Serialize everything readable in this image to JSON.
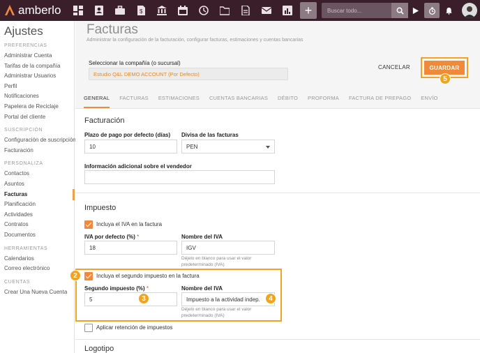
{
  "app": {
    "name": "amberlo"
  },
  "topbar": {
    "icons": [
      "dashboard-icon",
      "contacts-icon",
      "briefcase-icon",
      "billing-icon",
      "bank-icon",
      "calendar-icon",
      "history-icon",
      "folder-icon",
      "documents-icon",
      "mail-icon",
      "reports-icon"
    ],
    "search_placeholder": "Buscar todo..."
  },
  "sidebar": {
    "title": "Ajustes",
    "sections": [
      {
        "label": "PREFERENCIAS",
        "items": [
          "Administrar Cuenta",
          "Tarifas de la compañía",
          "Administrar Usuarios",
          "Perfil",
          "Notificaciones",
          "Papelera de Reciclaje",
          "Portal del cliente"
        ]
      },
      {
        "label": "SUSCRIPCIÓN",
        "items": [
          "Configuración de suscripción",
          "Facturación"
        ]
      },
      {
        "label": "PERSONALIZA",
        "items": [
          "Contactos",
          "Asuntos",
          "Facturas",
          "Planificación",
          "Actividades",
          "Contratos",
          "Documentos"
        ]
      },
      {
        "label": "HERRAMIENTAS",
        "items": [
          "Calendarios",
          "Correo electrónico"
        ]
      },
      {
        "label": "CUENTAS",
        "items": [
          "Crear Una Nueva Cuenta"
        ]
      }
    ],
    "active_item": "Facturas"
  },
  "header": {
    "title": "Facturas",
    "subtitle": "Administrar la configuración de la facturación, configurar facturas, estimaciones y cuentas bancarias",
    "company_label": "Seleccionar la compañía (o sucursal)",
    "company_value": "Estudio Q&L DEMO ACCOUNT (Por Defecto)",
    "cancel_label": "CANCELAR",
    "save_label": "GUARDAR"
  },
  "tabs": [
    "GENERAL",
    "FACTURAS",
    "ESTIMACIONES",
    "CUENTAS BANCARIAS",
    "DÉBITO",
    "PROFORMA",
    "FACTURA DE PREPAGO",
    "ENVÍO"
  ],
  "active_tab": "GENERAL",
  "facturacion": {
    "title": "Facturación",
    "payment_term_label": "Plazo de pago por defecto (días)",
    "payment_term_value": "10",
    "currency_label": "Divisa de las facturas",
    "currency_value": "PEN",
    "vendor_info_label": "Información adicional sobre el vendedor",
    "vendor_info_value": ""
  },
  "impuesto": {
    "title": "Impuesto",
    "include_iva_label": "Incluya el IVA en la factura",
    "include_iva_checked": true,
    "iva_default_label": "IVA por defecto (%)",
    "iva_default_value": "18",
    "iva_name_label": "Nombre del IVA",
    "iva_name_value": "IGV",
    "iva_name_help": "Déjelo en blanco para usar el valor predeterminado (IVA)",
    "include_second_label": "Incluya el segundo impuesto en la factura",
    "include_second_checked": true,
    "second_tax_label": "Segundo impuesto (%)",
    "second_tax_value": "5",
    "second_name_label": "Nombre del IVA",
    "second_name_value": "Impuesto a la actividad indep.",
    "second_name_help": "Déjelo en blanco para usar el valor predeterminado (IVA)",
    "withholding_label": "Aplicar retención de impuestos",
    "withholding_checked": false
  },
  "logotipo": {
    "title": "Logotipo"
  },
  "badges": {
    "b2": "2",
    "b3": "3",
    "b4": "4",
    "b5": "5"
  },
  "colors": {
    "accent": "#f08a3a",
    "highlight": "#f3a41e",
    "topbar": "#3a1f2b"
  }
}
